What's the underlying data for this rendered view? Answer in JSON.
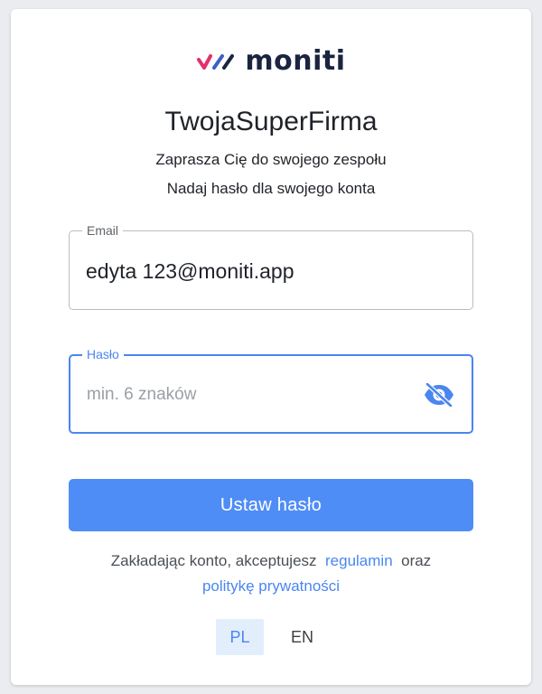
{
  "brand": {
    "name": "moniti",
    "mark_colors": [
      "#e2306c",
      "#3f5ec7",
      "#1b2440"
    ],
    "text_color": "#1b2440"
  },
  "invite": {
    "company": "TwojaSuperFirma",
    "message": "Zaprasza Cię do swojego zespołu",
    "instruction": "Nadaj hasło dla swojego konta"
  },
  "form": {
    "email": {
      "label": "Email",
      "value": "edyta 123@moniti.app"
    },
    "password": {
      "label": "Hasło",
      "value": "",
      "placeholder": "min. 6 znaków",
      "toggle_icon": "eye-off-icon"
    },
    "submit_label": "Ustaw hasło"
  },
  "terms": {
    "prefix": "Zakładając konto, akceptujesz",
    "regulations_link": "regulamin",
    "conjunction": "oraz",
    "privacy_link": "politykę prywatności"
  },
  "language": {
    "options": [
      "PL",
      "EN"
    ],
    "selected": "PL"
  },
  "colors": {
    "accent": "#4f8df6",
    "focus": "#4a86f0",
    "active_lang_bg": "#e3eefc"
  }
}
